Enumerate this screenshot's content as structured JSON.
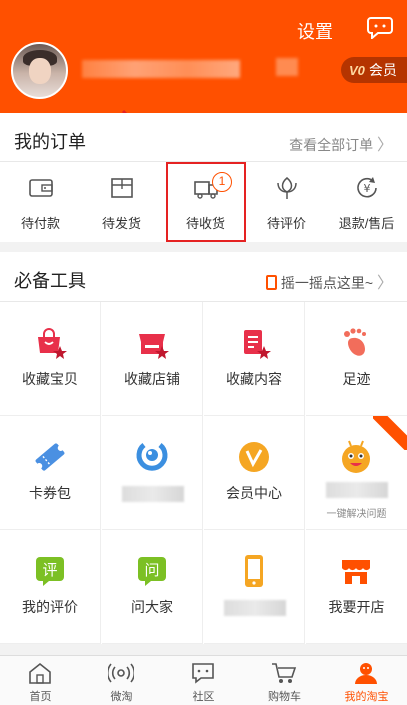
{
  "header": {
    "settings_label": "设置",
    "vip_mark": "V0",
    "vip_label": "会员"
  },
  "orders": {
    "title": "我的订单",
    "view_all": "查看全部订单",
    "items": [
      {
        "label": "待付款",
        "icon": "wallet-icon"
      },
      {
        "label": "待发货",
        "icon": "package-icon"
      },
      {
        "label": "待收货",
        "icon": "truck-icon",
        "badge": "1"
      },
      {
        "label": "待评价",
        "icon": "flower-icon"
      },
      {
        "label": "退款/售后",
        "icon": "refund-icon"
      }
    ]
  },
  "tools": {
    "title": "必备工具",
    "shake_hint": "摇一摇点这里~",
    "items": [
      {
        "label": "收藏宝贝",
        "icon": "favorite-goods-icon"
      },
      {
        "label": "收藏店铺",
        "icon": "favorite-shop-icon"
      },
      {
        "label": "收藏内容",
        "icon": "favorite-content-icon"
      },
      {
        "label": "足迹",
        "icon": "footprint-icon"
      },
      {
        "label": "卡券包",
        "icon": "coupon-icon"
      },
      {
        "label": "",
        "icon": "blue-circle-icon"
      },
      {
        "label": "会员中心",
        "icon": "member-center-icon"
      },
      {
        "label": "",
        "sub": "一键解决问题",
        "icon": "bee-service-icon"
      },
      {
        "label": "我的评价",
        "icon": "review-icon",
        "glyph": "评"
      },
      {
        "label": "问大家",
        "icon": "ask-icon",
        "glyph": "问"
      },
      {
        "label": "",
        "icon": "phone-icon"
      },
      {
        "label": "我要开店",
        "icon": "open-store-icon"
      }
    ]
  },
  "tabbar": {
    "items": [
      {
        "label": "首页",
        "icon": "home-icon"
      },
      {
        "label": "微淘",
        "icon": "weitao-icon"
      },
      {
        "label": "社区",
        "icon": "community-icon"
      },
      {
        "label": "购物车",
        "icon": "cart-icon"
      },
      {
        "label": "我的淘宝",
        "icon": "my-taobao-icon"
      }
    ]
  },
  "colors": {
    "brand": "#ff5000",
    "highlight": "#e52222"
  }
}
